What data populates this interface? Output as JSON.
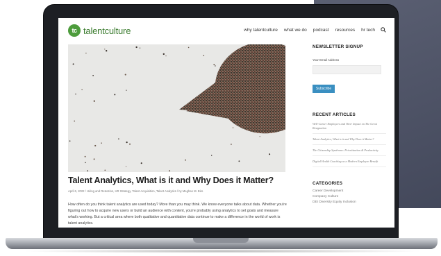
{
  "colors": {
    "brand_green": "#4d9c3c",
    "accent_blue": "#3a8fc1",
    "laptop_frame": "#1d1f24",
    "backdrop_panel": "#4f5467"
  },
  "header": {
    "logo_mark": "tc",
    "logo_text": "talentculture",
    "nav": [
      "why talentculture",
      "what we do",
      "podcast",
      "resources",
      "hr tech"
    ],
    "search_icon": "search-icon"
  },
  "hero": {
    "image_subject": "crowd-pie-chart"
  },
  "post": {
    "title": "Talent Analytics, What is it and Why Does it Matter?",
    "meta": "April 6, 2022  /  Hiring and Retention, HR Strategy, Talent Acquisition, Talent Analytics  /  by Meghan M. Biro",
    "excerpt": "How often do you think talent analytics are used today? More than you may think. We know everyone talks about data. Whether you're figuring out how to acquire new users or build an audience with content, you're probably using analytics to set goals and measure what's working. But a critical area where both qualitative and quantitative data continue to make a difference in the world of work is talent analytics."
  },
  "sidebar": {
    "newsletter": {
      "heading": "NEWSLETTER SIGNUP",
      "email_label": "Your Email Address",
      "email_value": "",
      "subscribe_label": "Subscribe"
    },
    "recent": {
      "heading": "RECENT ARTICLES",
      "items": [
        "Well-Career Employees and Their Impact on The Great Resignation",
        "Talent Analytics, What is it and Why Does it Matter?",
        "The Citizenship Syndrome: Prioritization & Productivity",
        "Digital Health Coaching as a Modern Employee Benefit"
      ]
    },
    "categories": {
      "heading": "CATEGORIES",
      "items": [
        "Career Development",
        "Company Culture",
        "DEI Diversity Equity Inclusion"
      ]
    }
  }
}
